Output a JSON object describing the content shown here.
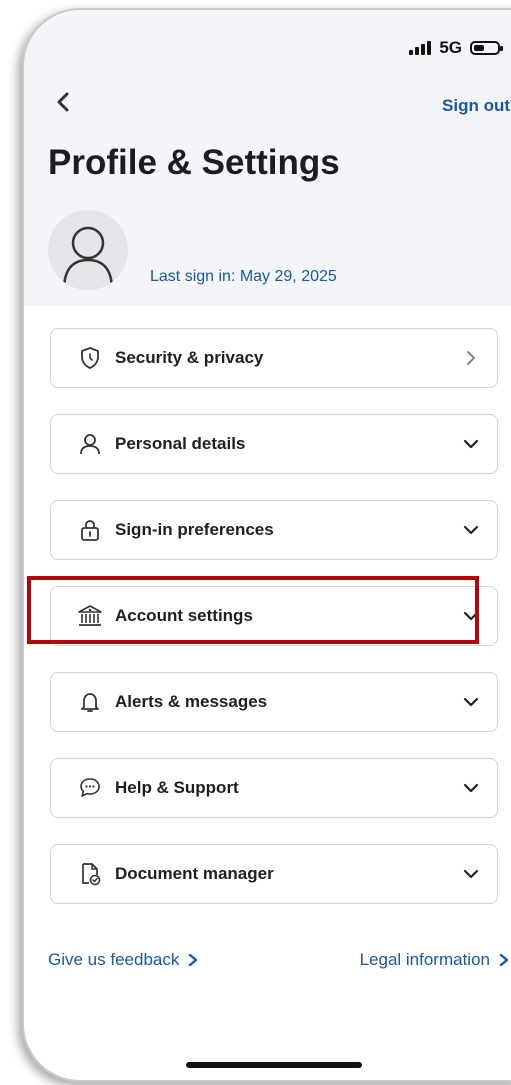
{
  "status_bar": {
    "network": "5G",
    "icons": [
      "signal-icon",
      "battery-icon"
    ]
  },
  "header": {
    "back_icon": "chevron-left-icon",
    "sign_out": "Sign out",
    "title": "Profile & Settings",
    "last_sign_in": "Last sign in: May 29, 2025"
  },
  "menu": {
    "items": [
      {
        "label": "Security & privacy",
        "icon": "shield-icon",
        "chevron": "chevron-right-icon"
      },
      {
        "label": "Personal details",
        "icon": "person-icon",
        "chevron": "chevron-down-icon"
      },
      {
        "label": "Sign-in preferences",
        "icon": "lock-icon",
        "chevron": "chevron-down-icon"
      },
      {
        "label": "Account settings",
        "icon": "bank-icon",
        "chevron": "chevron-down-icon",
        "highlighted": true
      },
      {
        "label": "Alerts & messages",
        "icon": "bell-icon",
        "chevron": "chevron-down-icon"
      },
      {
        "label": "Help & Support",
        "icon": "chat-icon",
        "chevron": "chevron-down-icon"
      },
      {
        "label": "Document manager",
        "icon": "document-icon",
        "chevron": "chevron-down-icon"
      }
    ]
  },
  "footer": {
    "feedback": "Give us feedback",
    "legal": "Legal information"
  },
  "colors": {
    "accent": "#1a57a4",
    "highlight": "#b3060b",
    "header_bg": "#f3f5f8"
  }
}
